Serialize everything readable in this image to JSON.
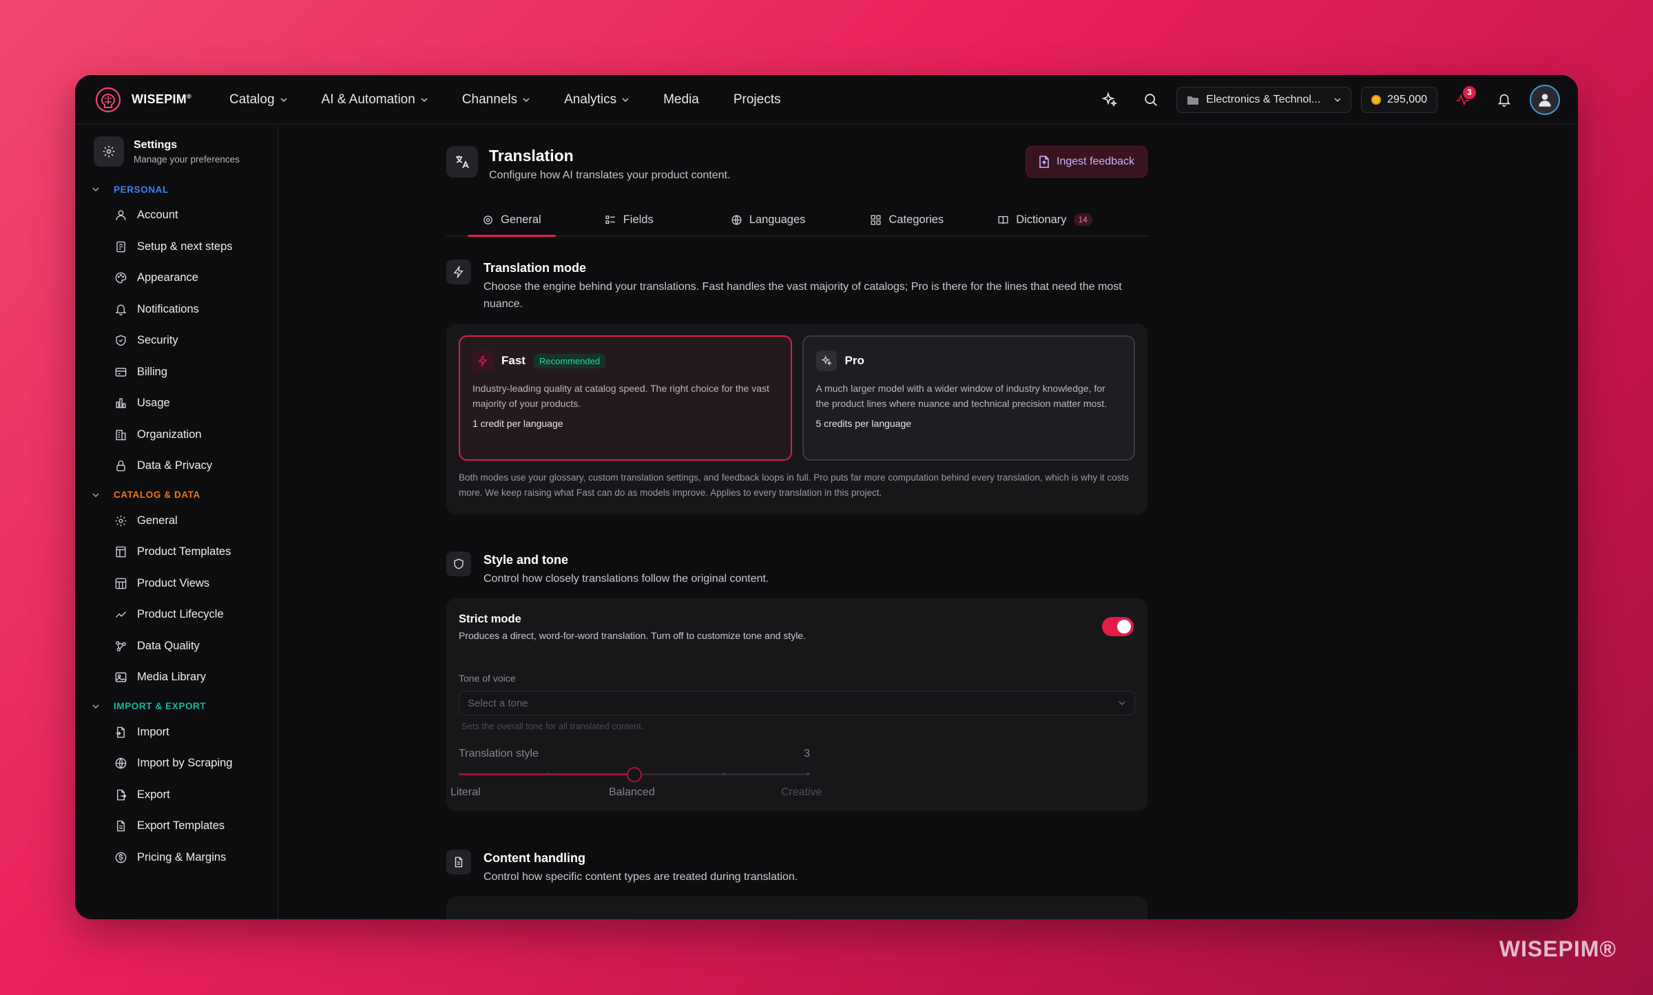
{
  "brand": {
    "name": "WISEPIM",
    "mark": "®",
    "watermark": "WISEPIM®"
  },
  "nav": [
    {
      "label": "Catalog",
      "dropdown": true
    },
    {
      "label": "AI & Automation",
      "dropdown": true
    },
    {
      "label": "Channels",
      "dropdown": true
    },
    {
      "label": "Analytics",
      "dropdown": true
    },
    {
      "label": "Media",
      "dropdown": false
    },
    {
      "label": "Projects",
      "dropdown": false
    }
  ],
  "topbar": {
    "project": "Electronics & Technol...",
    "credits": "295,000",
    "activity_badge": "3"
  },
  "sidebar": {
    "title": "Settings",
    "subtitle": "Manage your preferences",
    "groups": [
      {
        "label": "PERSONAL",
        "color": "#3b82f6",
        "items": [
          "Account",
          "Setup & next steps",
          "Appearance",
          "Notifications",
          "Security",
          "Billing",
          "Usage",
          "Organization",
          "Data & Privacy"
        ]
      },
      {
        "label": "CATALOG & DATA",
        "color": "#f97316",
        "items": [
          "General",
          "Product Templates",
          "Product Views",
          "Product Lifecycle",
          "Data Quality",
          "Media Library"
        ]
      },
      {
        "label": "IMPORT & EXPORT",
        "color": "#14b8a6",
        "items": [
          "Import",
          "Import by Scraping",
          "Export",
          "Export Templates",
          "Pricing & Margins"
        ]
      }
    ]
  },
  "page": {
    "title": "Translation",
    "subtitle": "Configure how AI translates your product content.",
    "ingest_label": "Ingest feedback",
    "tabs": [
      {
        "label": "General"
      },
      {
        "label": "Fields"
      },
      {
        "label": "Languages"
      },
      {
        "label": "Categories"
      },
      {
        "label": "Dictionary",
        "count": "14"
      }
    ]
  },
  "mode": {
    "title": "Translation mode",
    "desc": "Choose the engine behind your translations. Fast handles the vast majority of catalogs; Pro is there for the lines that need the most nuance.",
    "fast": {
      "name": "Fast",
      "badge": "Recommended",
      "desc": "Industry-leading quality at catalog speed. The right choice for the vast majority of your products.",
      "price": "1 credit per language"
    },
    "pro": {
      "name": "Pro",
      "desc": "A much larger model with a wider window of industry knowledge, for the product lines where nuance and technical precision matter most.",
      "price": "5 credits per language"
    },
    "note": "Both modes use your glossary, custom translation settings, and feedback loops in full. Pro puts far more computation behind every translation, which is why it costs more. We keep raising what Fast can do as models improve. Applies to every translation in this project."
  },
  "style": {
    "title": "Style and tone",
    "desc": "Control how closely translations follow the original content.",
    "strict_title": "Strict mode",
    "strict_desc": "Produces a direct, word-for-word translation. Turn off to customize tone and style.",
    "tone_label": "Tone of voice",
    "tone_placeholder": "Select a tone",
    "tone_hint": "Sets the overall tone for all translated content.",
    "style_label": "Translation style",
    "style_value": "3",
    "style_fraction": 0.5,
    "left": "Literal",
    "mid": "Balanced",
    "right": "Creative"
  },
  "content": {
    "title": "Content handling",
    "desc": "Control how specific content types are treated during translation."
  }
}
